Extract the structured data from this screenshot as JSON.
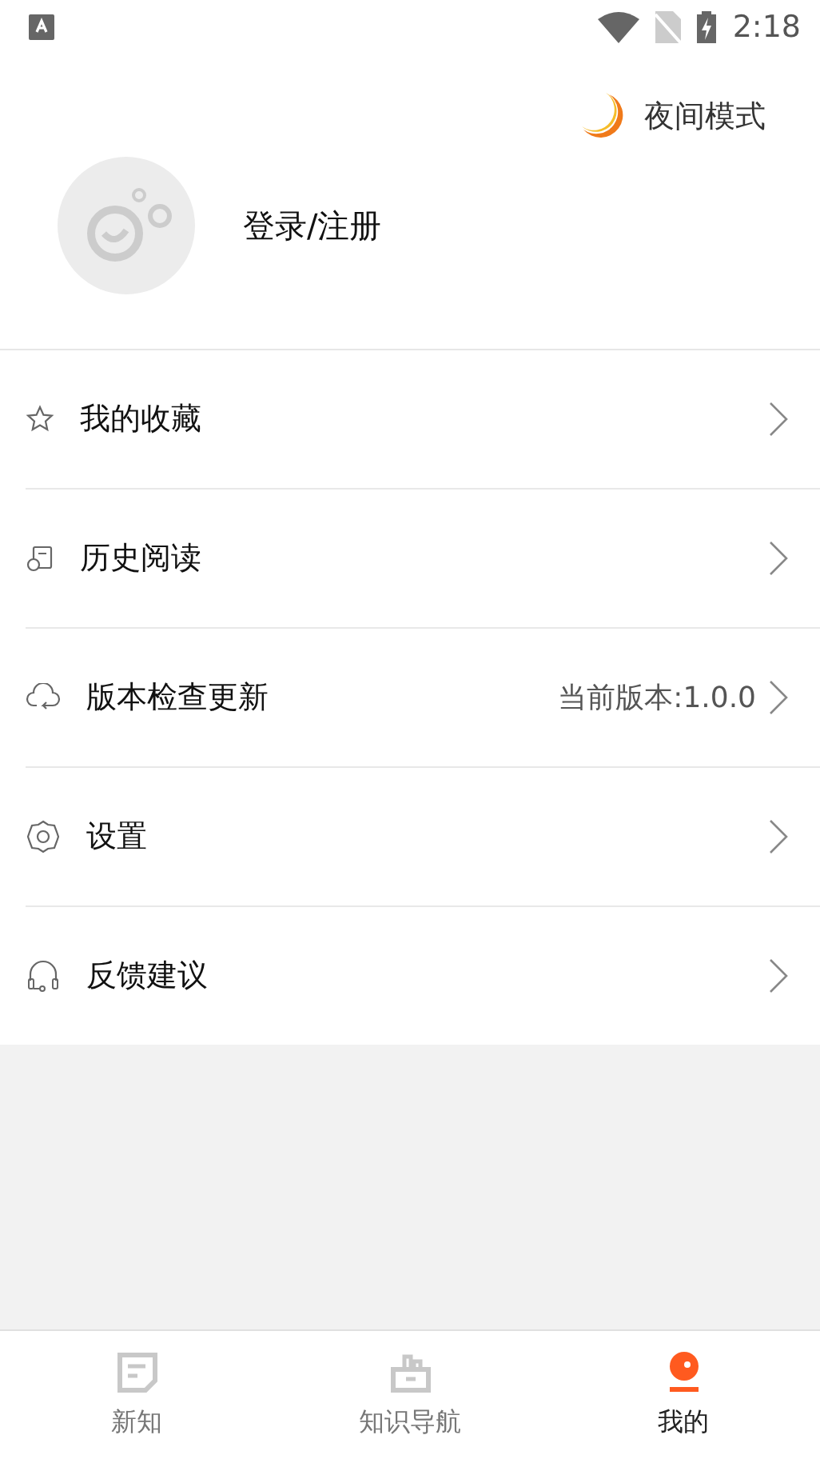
{
  "status_bar": {
    "time": "2:18"
  },
  "night_mode": {
    "label": "夜间模式"
  },
  "profile": {
    "login": "登录/注册"
  },
  "menu": [
    {
      "kind": "star",
      "label": "我的收藏"
    },
    {
      "kind": "history",
      "label": "历史阅读"
    },
    {
      "kind": "cloud",
      "label": "版本检查更新",
      "value": "当前版本:1.0.0"
    },
    {
      "kind": "gear",
      "label": "设置"
    },
    {
      "kind": "headset",
      "label": "反馈建议"
    }
  ],
  "tabs": [
    {
      "kind": "news",
      "label": "新知",
      "selected": false
    },
    {
      "kind": "nav",
      "label": "知识导航",
      "selected": false
    },
    {
      "kind": "me",
      "label": "我的",
      "selected": true
    }
  ]
}
